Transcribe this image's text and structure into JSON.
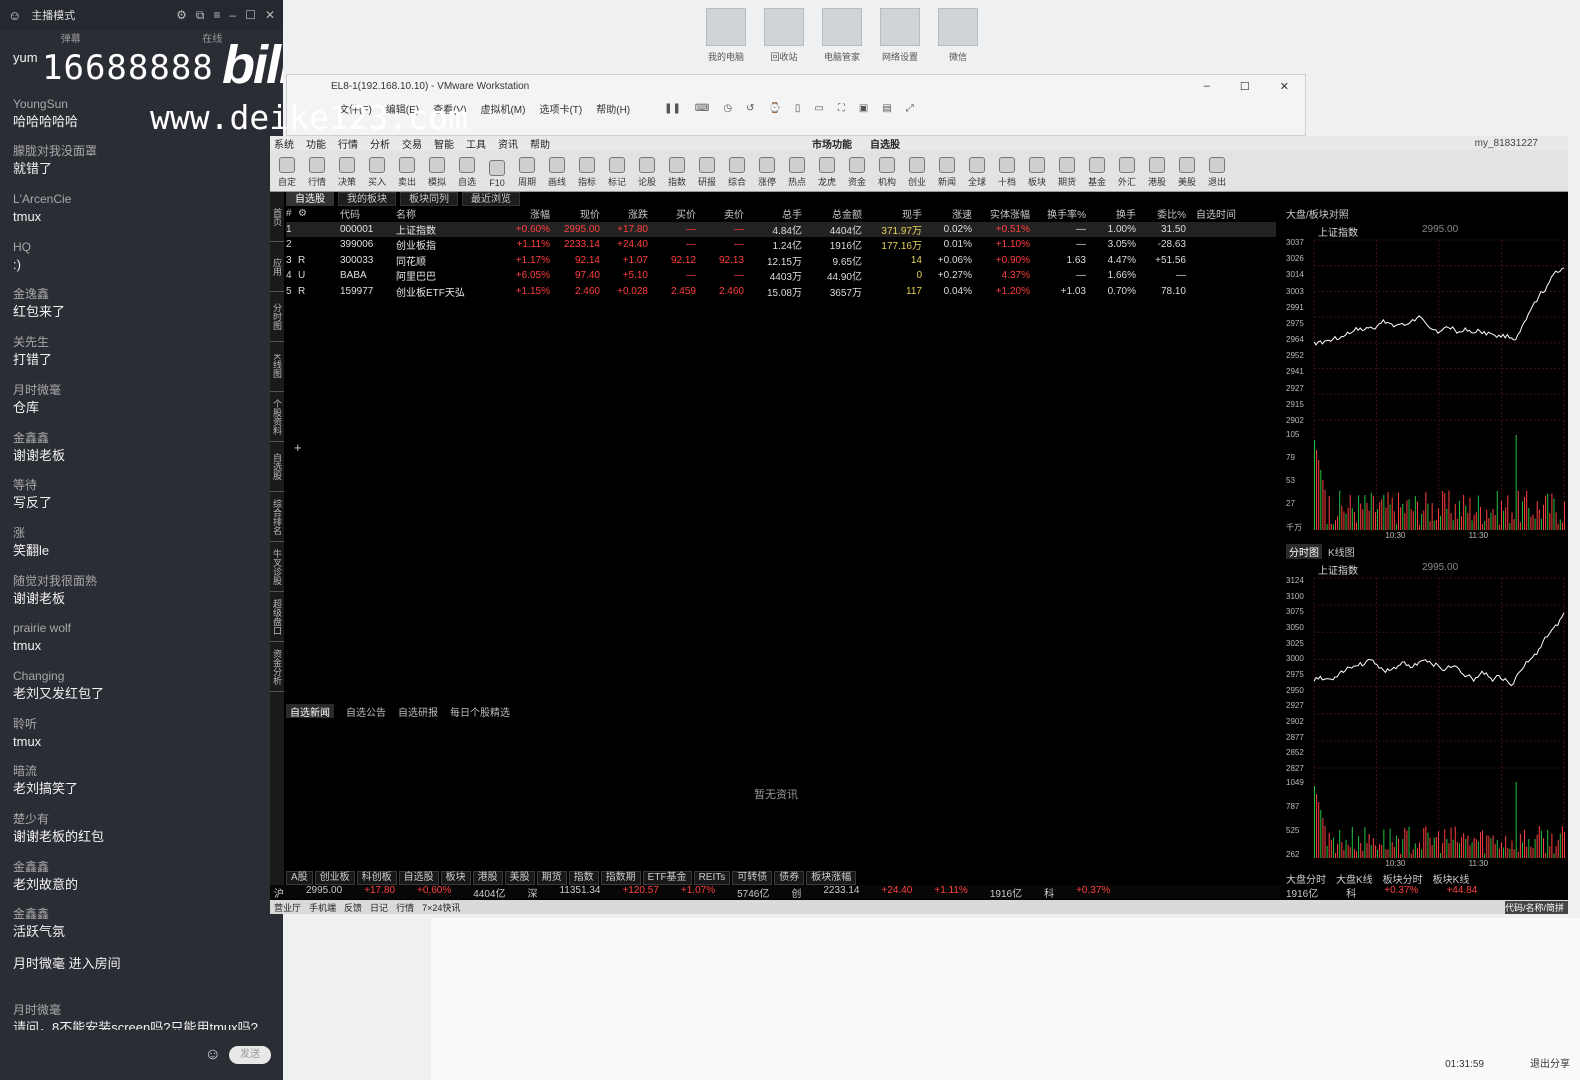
{
  "chat": {
    "topbar": {
      "mode": "主播模式"
    },
    "tabs": [
      "弹幕",
      "在线"
    ],
    "messages": [
      {
        "user": "",
        "text": "yum"
      },
      {
        "user": "YoungSun",
        "text": "哈哈哈哈哈"
      },
      {
        "user": "朦胧对我没面罩",
        "text": "就错了"
      },
      {
        "user": "L'ArcenCie",
        "text": "tmux"
      },
      {
        "user": "HQ",
        "text": ":)"
      },
      {
        "user": "金逸鑫",
        "text": "红包来了"
      },
      {
        "user": "关先生",
        "text": "打错了"
      },
      {
        "user": "月时微毫",
        "text": "仓库"
      },
      {
        "user": "金鑫鑫",
        "text": "谢谢老板"
      },
      {
        "user": "等待",
        "text": "写反了"
      },
      {
        "user": "涨",
        "text": "笑翻le"
      },
      {
        "user": "随觉对我很面熟",
        "text": "谢谢老板"
      },
      {
        "user": "prairie wolf",
        "text": "tmux"
      },
      {
        "user": "Changing",
        "text": "老刘又发红包了"
      },
      {
        "user": "聆听",
        "text": "tmux"
      },
      {
        "user": "暗流",
        "text": "老刘搞笑了"
      },
      {
        "user": "楚少有",
        "text": "谢谢老板的红包"
      },
      {
        "user": "金鑫鑫",
        "text": "老刘故意的"
      },
      {
        "user": "金鑫鑫",
        "text": "活跃气氛"
      },
      {
        "user": "",
        "text": "月时微毫 进入房间"
      },
      {
        "user": "月时微毫",
        "text": "请问，8不能安装screen吗?只能用tmux吗?"
      }
    ],
    "send_label": "发送"
  },
  "watermark": {
    "number": "16688888",
    "logo": "bilibili",
    "url": "www.deike123.com"
  },
  "desktop": {
    "icons": [
      "我的电脑",
      "回收站",
      "电脑管家",
      "网络设置",
      "微信"
    ],
    "time": "01:31:59",
    "exit_label": "退出分享"
  },
  "vmware": {
    "title": "EL8-1(192.168.10.10) - VMware Workstation",
    "menu": [
      "文件(F)",
      "编辑(E)",
      "查看(V)",
      "虚拟机(M)",
      "选项卡(T)",
      "帮助(H)"
    ]
  },
  "app": {
    "menubar": [
      "系统",
      "功能",
      "行情",
      "分析",
      "交易",
      "智能",
      "工具",
      "资讯",
      "帮助"
    ],
    "center_tabs": [
      "市场功能",
      "自选股"
    ],
    "account": "my_81831227",
    "toolbar": [
      "自定",
      "行情",
      "决策",
      "买入",
      "卖出",
      "模拟",
      "自选",
      "F10",
      "周期",
      "画线",
      "指标",
      "标记",
      "论股",
      "指数",
      "研报",
      "综合",
      "涨停",
      "热点",
      "龙虎",
      "资金",
      "机构",
      "创业",
      "新闻",
      "全球",
      "十档",
      "板块",
      "期货",
      "基金",
      "外汇",
      "港股",
      "美股",
      "退出"
    ],
    "side_tabs": [
      "首页",
      "应用",
      "分时图",
      "K线图",
      "个股资料",
      "自选股",
      "综合排名",
      "牛叉诊股",
      "超级盘口",
      "资金分析"
    ],
    "sub_tabs": [
      "自选股",
      "我的板块",
      "板块同列",
      "最近浏览"
    ],
    "grid": {
      "headers": [
        "#",
        "⚙",
        "",
        "代码",
        "名称",
        "涨幅",
        "现价",
        "涨跌",
        "买价",
        "卖价",
        "总手",
        "总金额",
        "现手",
        "涨速",
        "实体涨幅",
        "换手率%",
        "换手",
        "委比%",
        "自选时间"
      ],
      "rows": [
        {
          "n": "1",
          "flag": "",
          "code": "000001",
          "name": "上证指数",
          "pct": "+0.60%",
          "price": "2995.00",
          "chg": "+17.80",
          "bid": "—",
          "ask": "—",
          "vol": "4.84亿",
          "amt": "4404亿",
          "cur": "371.97万",
          "spd": "0.02%",
          "body": "+0.51%",
          "tr": "—",
          "turn": "1.00%",
          "wb": "31.50",
          "time": "",
          "dir": "up"
        },
        {
          "n": "2",
          "flag": "",
          "code": "399006",
          "name": "创业板指",
          "pct": "+1.11%",
          "price": "2233.14",
          "chg": "+24.40",
          "bid": "—",
          "ask": "—",
          "vol": "1.24亿",
          "amt": "1916亿",
          "cur": "177.16万",
          "spd": "0.01%",
          "body": "+1.10%",
          "tr": "—",
          "turn": "3.05%",
          "wb": "-28.63",
          "time": "",
          "dir": "up"
        },
        {
          "n": "3",
          "flag": "R",
          "code": "300033",
          "name": "同花顺",
          "pct": "+1.17%",
          "price": "92.14",
          "chg": "+1.07",
          "bid": "92.12",
          "ask": "92.13",
          "vol": "12.15万",
          "amt": "9.65亿",
          "cur": "14",
          "spd": "+0.06%",
          "body": "+0.90%",
          "tr": "1.63",
          "turn": "4.47%",
          "wb": "+51.56",
          "time": "",
          "dir": "up"
        },
        {
          "n": "4",
          "flag": "U",
          "code": "BABA",
          "name": "阿里巴巴",
          "pct": "+6.05%",
          "price": "97.40",
          "chg": "+5.10",
          "bid": "—",
          "ask": "—",
          "vol": "4403万",
          "amt": "44.90亿",
          "cur": "0",
          "spd": "+0.27%",
          "body": "4.37%",
          "tr": "—",
          "turn": "1.66%",
          "wb": "—",
          "time": "",
          "dir": "up"
        },
        {
          "n": "5",
          "flag": "R",
          "code": "159977",
          "name": "创业板ETF天弘",
          "pct": "+1.15%",
          "price": "2.460",
          "chg": "+0.028",
          "bid": "2.459",
          "ask": "2.460",
          "vol": "15.08万",
          "amt": "3657万",
          "cur": "117",
          "spd": "0.04%",
          "body": "+1.20%",
          "tr": "+1.03",
          "turn": "0.70%",
          "wb": "78.10",
          "time": "",
          "dir": "up"
        }
      ]
    },
    "add_label": "+",
    "news_tabs": [
      "自选新闻",
      "自选公告",
      "自选研报",
      "每日个股精选"
    ],
    "news_empty": "暂无资讯",
    "sector_tabs": [
      "A股",
      "创业板",
      "科创板",
      "自选股",
      "板块",
      "港股",
      "美股",
      "期货",
      "指数",
      "指数期",
      "ETF基金",
      "REITs",
      "可转债",
      "债券",
      "板块涨幅"
    ],
    "ticker": [
      "沪",
      "2995.00",
      "+17.80",
      "+0.60%",
      "4404亿",
      "深",
      "11351.34",
      "+120.57",
      "+1.07%",
      "5746亿",
      "创",
      "2233.14",
      "+24.40",
      "+1.11%",
      "1916亿",
      "科",
      "+0.37%"
    ],
    "statusbar": [
      "营业厅",
      "手机端",
      "反馈",
      "日记",
      "行情",
      "7×24快讯"
    ],
    "statusbar_right": "代码/名称/简拼",
    "right_panel": {
      "header": "大盘/板块对照",
      "chart1_title": "上证指数",
      "chart1_sub": "2995.00",
      "chart1_ylabels": [
        "3037",
        "3026",
        "3014",
        "3003",
        "2991",
        "2975",
        "2964",
        "2952",
        "2941",
        "2927",
        "2915",
        "2902"
      ],
      "chart1_vol_labels": [
        "105",
        "79",
        "53",
        "27",
        "千万"
      ],
      "chart1_xlabels": [
        "10:30",
        "11:30"
      ],
      "chart_tabs": [
        "分时图",
        "K线图"
      ],
      "chart2_title": "上证指数",
      "chart2_sub": "2995.00",
      "chart2_ylabels": [
        "3124",
        "3100",
        "3075",
        "3050",
        "3025",
        "3000",
        "2975",
        "2950",
        "2927",
        "2902",
        "2877",
        "2852",
        "2827"
      ],
      "chart2_vol_labels": [
        "1049",
        "787",
        "525",
        "262"
      ],
      "chart2_xlabels": [
        "10:30",
        "11:30"
      ],
      "bottom_tabs": [
        "大盘分时",
        "大盘K线",
        "板块分时",
        "板块K线"
      ],
      "bottom_vals": [
        "1916亿",
        "科",
        "+0.37%",
        "+44.84"
      ]
    }
  }
}
